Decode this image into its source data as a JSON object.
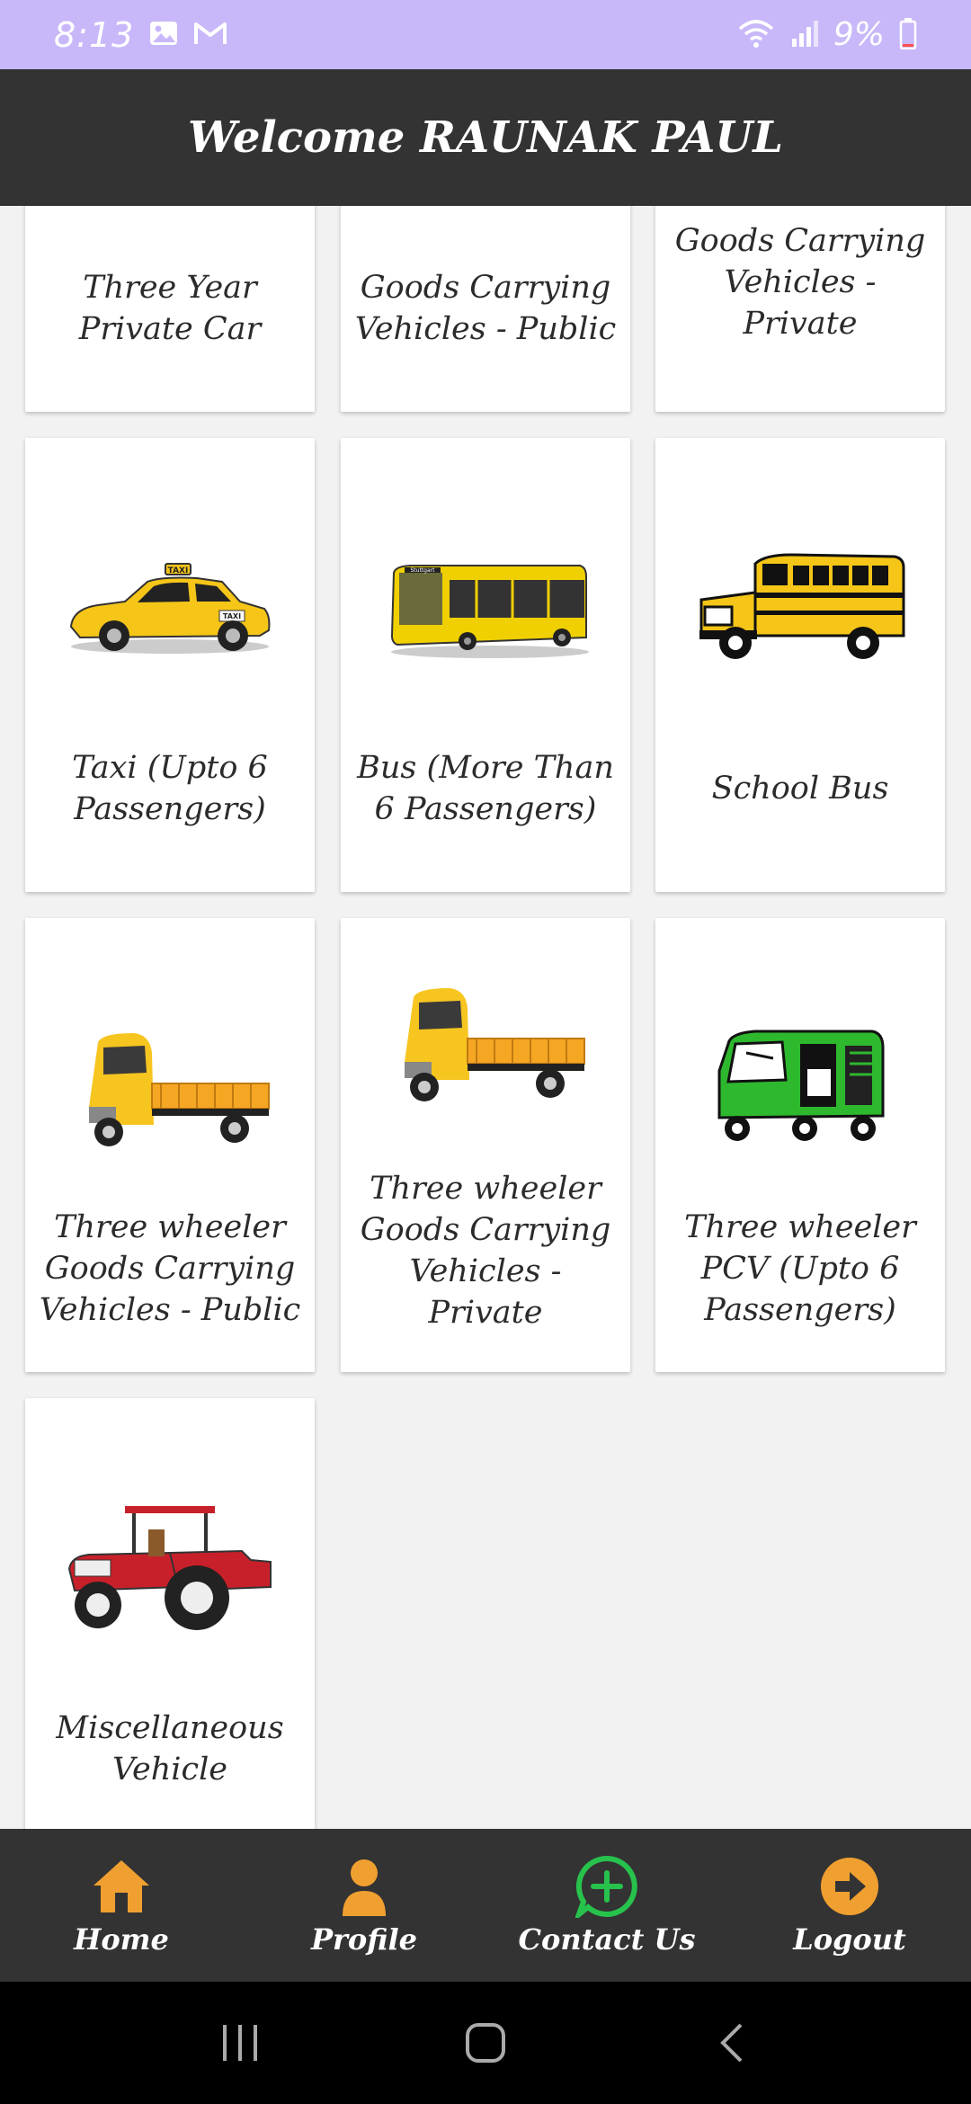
{
  "status_bar": {
    "time": "8:13",
    "battery_pct": "9%",
    "icons": [
      "gallery-icon",
      "gmail-icon",
      "wifi-icon",
      "signal-icon",
      "battery-icon"
    ]
  },
  "header": {
    "title": "Welcome RAUNAK PAUL"
  },
  "cards": [
    {
      "label": "Three Year Private Car",
      "icon": "private-car-icon"
    },
    {
      "label": "Goods Carrying Vehicles - Public",
      "icon": "goods-public-icon"
    },
    {
      "label": "Goods Carrying Vehicles - Private",
      "icon": "goods-private-icon"
    },
    {
      "label": "Taxi (Upto 6 Passengers)",
      "icon": "taxi-icon"
    },
    {
      "label": "Bus (More Than 6 Passengers)",
      "icon": "bus-icon"
    },
    {
      "label": "School Bus",
      "icon": "school-bus-icon"
    },
    {
      "label": "Three wheeler Goods Carrying Vehicles - Public",
      "icon": "three-wheeler-goods-icon"
    },
    {
      "label": "Three wheeler Goods Carrying Vehicles - Private",
      "icon": "three-wheeler-goods-icon"
    },
    {
      "label": "Three wheeler PCV (Upto 6 Passengers)",
      "icon": "auto-rickshaw-icon"
    },
    {
      "label": "Miscellaneous Vehicle",
      "icon": "tractor-icon"
    }
  ],
  "bus_sign": "Stuttgart",
  "taxi_sign": "TAXI",
  "bottom_nav": [
    {
      "label": "Home",
      "icon": "home-icon"
    },
    {
      "label": "Profile",
      "icon": "profile-icon"
    },
    {
      "label": "Contact Us",
      "icon": "whatsapp-icon"
    },
    {
      "label": "Logout",
      "icon": "logout-icon"
    }
  ],
  "colors": {
    "status_bar": "#c9b8f9",
    "header": "#333333",
    "accent": "#f0a030"
  }
}
